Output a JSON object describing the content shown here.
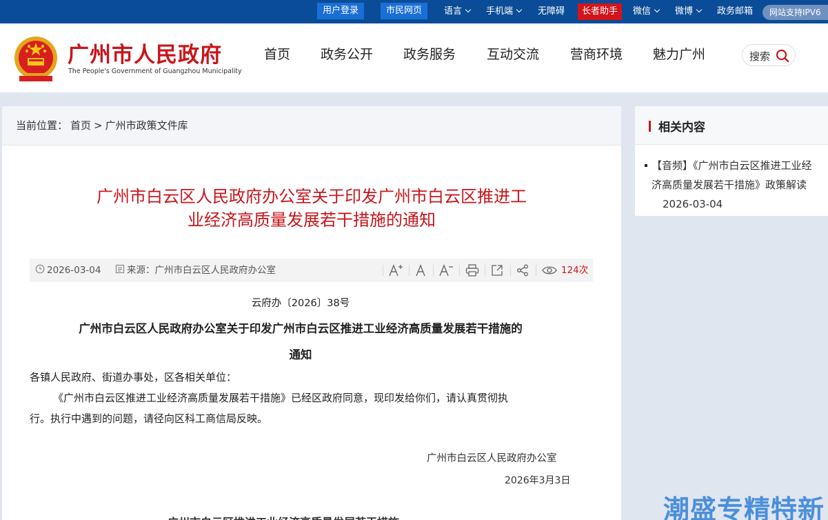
{
  "topbar": {
    "login": "用户登录",
    "citizen_page": "市民网页",
    "language": "语言",
    "mobile": "手机端",
    "accessibility": "无障碍",
    "elder_helper": "长者助手",
    "wechat": "微信",
    "weibo": "微博",
    "gov_mail": "政务邮箱",
    "ipv6": "网站支持IPV6"
  },
  "header": {
    "site_title": "广州市人民政府",
    "site_subtitle": "The People's Government of Guangzhou Municipality",
    "nav": [
      "首页",
      "政务公开",
      "政务服务",
      "互动交流",
      "营商环境",
      "魅力广州"
    ],
    "search_label": "搜索"
  },
  "breadcrumb": {
    "prefix": "当前位置：",
    "home": "首页",
    "sep": ">",
    "current": "广州市政策文件库"
  },
  "article": {
    "title_line1": "广州市白云区人民政府办公室关于印发广州市白云区推进工",
    "title_line2": "业经济高质量发展若干措施的通知",
    "date": "2026-03-04",
    "source": "来源：广州市白云区人民政府办公室",
    "views": "124次",
    "doc_no": "云府办〔2026〕38号",
    "body_title_line1": "广州市白云区人民政府办公室关于印发广州市白云区推进工业经济高质量发展若干措施的",
    "body_title_line2": "通知",
    "addressee": "各镇人民政府、街道办事处，区各相关单位：",
    "para1_line1": "《广州市白云区推进工业经济高质量发展若干措施》已经区政府同意，现印发给你们，请认真贯彻执",
    "para1_line2": "行。执行中遇到的问题，请径向区科工商信局反映。",
    "signer": "广州市白云区人民政府办公室",
    "sign_date": "2026年3月3日",
    "next_title": "广州市白云区推进工业经济高质量发展若干措施"
  },
  "side": {
    "title": "相关内容",
    "item_text": "【音频】《广州市白云区推进工业经济高质量发展若干措施》政策解读",
    "item_date": "2026-03-04"
  },
  "watermark": "潮盛专精特新",
  "colors": {
    "topbar": "#0a4c97",
    "accent_red": "#c8151b",
    "button_blue": "#1a6fd6"
  }
}
